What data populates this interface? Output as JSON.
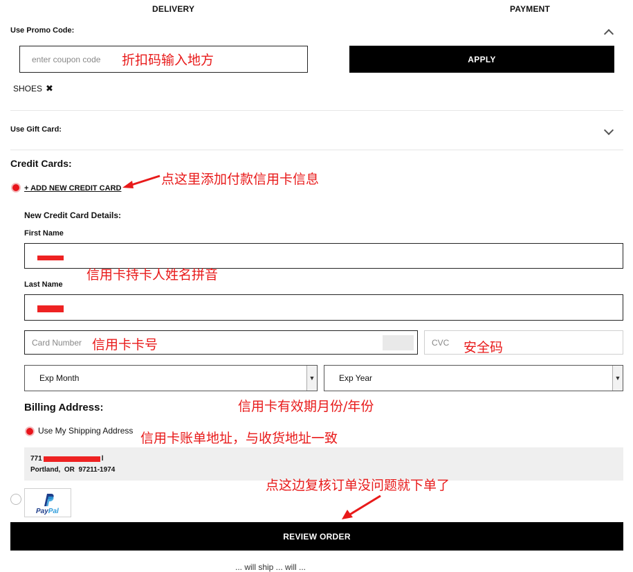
{
  "steps": {
    "delivery": "DELIVERY",
    "payment": "PAYMENT"
  },
  "promo": {
    "label": "Use Promo Code:",
    "placeholder": "enter coupon code",
    "apply": "APPLY",
    "applied_code": "SHOES",
    "remove_glyph": "✖"
  },
  "gift_card": {
    "label": "Use Gift Card:"
  },
  "credit_cards": {
    "heading": "Credit Cards:",
    "add_new": "+ ADD NEW CREDIT CARD",
    "details_heading": "New Credit Card Details:",
    "first_name_label": "First Name",
    "last_name_label": "Last Name",
    "card_number_placeholder": "Card Number",
    "cvc_placeholder": "CVC",
    "exp_month": "Exp Month",
    "exp_year": "Exp Year"
  },
  "billing": {
    "heading": "Billing Address:",
    "use_shipping": "Use My Shipping Address",
    "address_line1_prefix": "771",
    "address_line1_suffix": "l",
    "address_line2": "Portland,  OR  97211-1974"
  },
  "paypal": {
    "logo_pay": "Pay",
    "logo_pal": "Pal"
  },
  "review_button": "REVIEW ORDER",
  "footer_cut": "... will ship ... will ...",
  "annotations": {
    "promo_input": "折扣码输入地方",
    "add_card": "点这里添加付款信用卡信息",
    "name": "信用卡持卡人姓名拼音",
    "card_number": "信用卡卡号",
    "cvc": "安全码",
    "expiry": "信用卡有效期月份/年份",
    "billing": "信用卡账单地址，与收货地址一致",
    "review": "点这边复核订单没问题就下单了"
  },
  "colors": {
    "accent_red": "#e8141b",
    "annotation_red": "#e81a1a",
    "button_black": "#000000"
  }
}
